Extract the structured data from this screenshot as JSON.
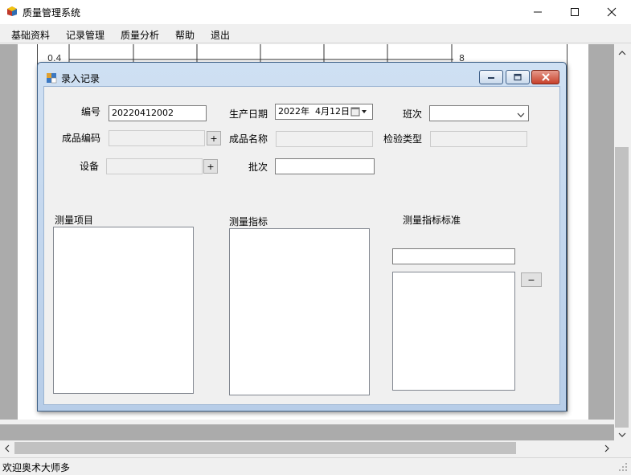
{
  "app": {
    "title": "质量管理系统"
  },
  "menu": {
    "items": [
      "基础资料",
      "记录管理",
      "质量分析",
      "帮助",
      "退出"
    ]
  },
  "chart_peek": {
    "left_tick": "0.4",
    "right_tick": "8"
  },
  "dialog": {
    "title": "录入记录",
    "fields": {
      "number_label": "编号",
      "number_value": "20220412002",
      "prod_date_label": "生产日期",
      "prod_date_value": "2022年  4月12日",
      "shift_label": "班次",
      "shift_value": "",
      "product_code_label": "成品编码",
      "product_name_label": "成品名称",
      "inspection_type_label": "检验类型",
      "equipment_label": "设备",
      "batch_label": "批次",
      "batch_value": ""
    },
    "lists": {
      "items_label": "测量项目",
      "indicators_label": "测量指标",
      "standards_label": "测量指标标准"
    },
    "buttons": {
      "plus": "+",
      "minus": "−"
    }
  },
  "status": {
    "text": "欢迎奥术大师多"
  }
}
